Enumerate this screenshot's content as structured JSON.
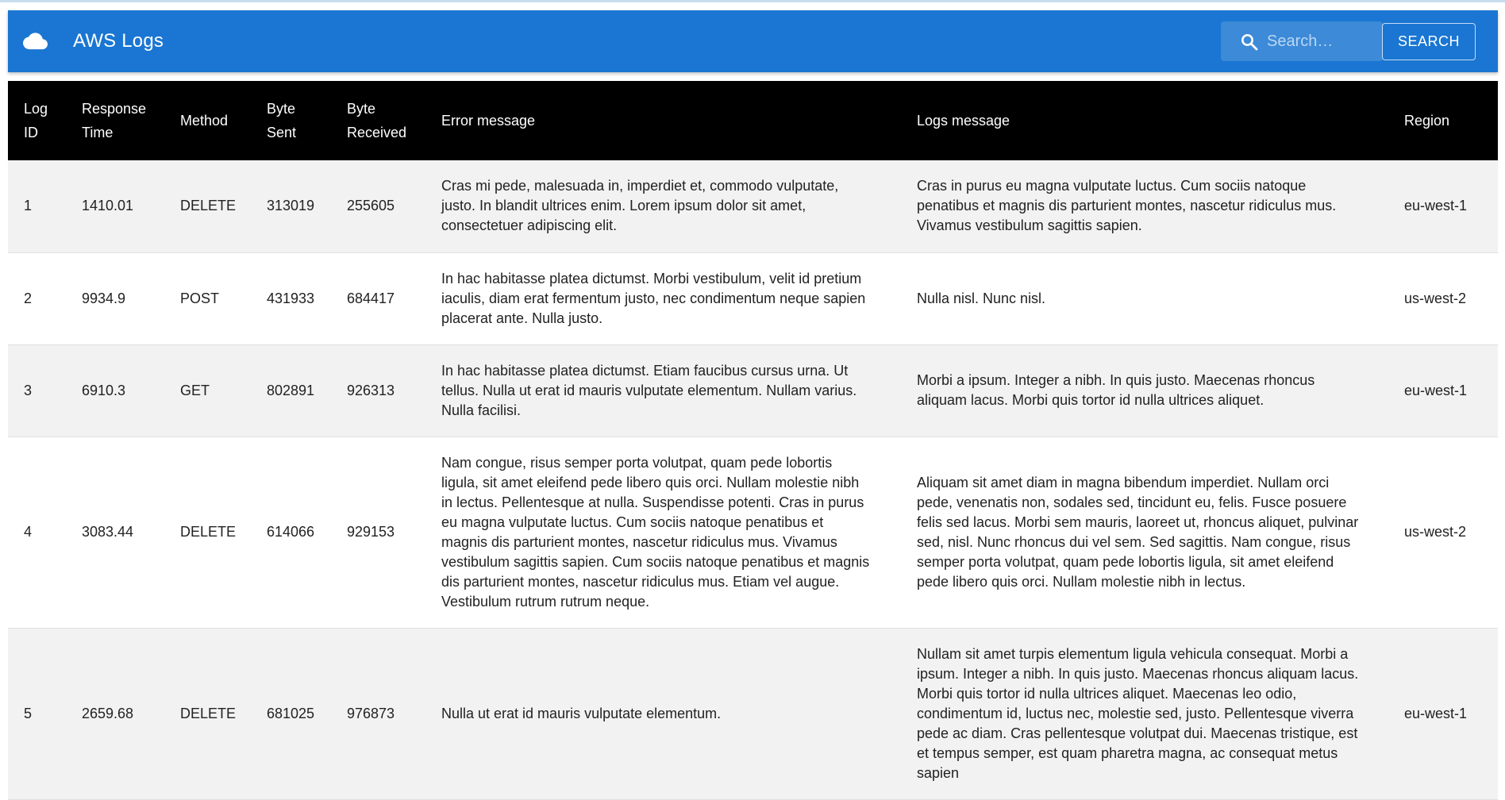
{
  "app": {
    "title": "AWS Logs",
    "icon": "cloud-icon"
  },
  "search": {
    "placeholder": "Search…",
    "value": "",
    "button_label": "SEARCH",
    "icon": "search-icon"
  },
  "colors": {
    "appbar": "#1a76d2",
    "header_row": "#000000",
    "row_odd": "#f2f2f2",
    "row_even": "#ffffff"
  },
  "table": {
    "columns": [
      "Log ID",
      "Response Time",
      "Method",
      "Byte Sent",
      "Byte Received",
      "Error message",
      "Logs message",
      "Region"
    ],
    "rows": [
      {
        "id": "1",
        "response_time": "1410.01",
        "method": "DELETE",
        "byte_sent": "313019",
        "byte_received": "255605",
        "error_message": "Cras mi pede, malesuada in, imperdiet et, commodo vulputate, justo. In blandit ultrices enim. Lorem ipsum dolor sit amet, consectetuer adipiscing elit.",
        "logs_message": "Cras in purus eu magna vulputate luctus. Cum sociis natoque penatibus et magnis dis parturient montes, nascetur ridiculus mus. Vivamus vestibulum sagittis sapien.",
        "region": "eu-west-1"
      },
      {
        "id": "2",
        "response_time": "9934.9",
        "method": "POST",
        "byte_sent": "431933",
        "byte_received": "684417",
        "error_message": "In hac habitasse platea dictumst. Morbi vestibulum, velit id pretium iaculis, diam erat fermentum justo, nec condimentum neque sapien placerat ante. Nulla justo.",
        "logs_message": "Nulla nisl. Nunc nisl.",
        "region": "us-west-2"
      },
      {
        "id": "3",
        "response_time": "6910.3",
        "method": "GET",
        "byte_sent": "802891",
        "byte_received": "926313",
        "error_message": "In hac habitasse platea dictumst. Etiam faucibus cursus urna. Ut tellus. Nulla ut erat id mauris vulputate elementum. Nullam varius. Nulla facilisi.",
        "logs_message": "Morbi a ipsum. Integer a nibh. In quis justo. Maecenas rhoncus aliquam lacus. Morbi quis tortor id nulla ultrices aliquet.",
        "region": "eu-west-1"
      },
      {
        "id": "4",
        "response_time": "3083.44",
        "method": "DELETE",
        "byte_sent": "614066",
        "byte_received": "929153",
        "error_message": "Nam congue, risus semper porta volutpat, quam pede lobortis ligula, sit amet eleifend pede libero quis orci. Nullam molestie nibh in lectus. Pellentesque at nulla. Suspendisse potenti. Cras in purus eu magna vulputate luctus. Cum sociis natoque penatibus et magnis dis parturient montes, nascetur ridiculus mus. Vivamus vestibulum sagittis sapien. Cum sociis natoque penatibus et magnis dis parturient montes, nascetur ridiculus mus. Etiam vel augue. Vestibulum rutrum rutrum neque.",
        "logs_message": "Aliquam sit amet diam in magna bibendum imperdiet. Nullam orci pede, venenatis non, sodales sed, tincidunt eu, felis. Fusce posuere felis sed lacus. Morbi sem mauris, laoreet ut, rhoncus aliquet, pulvinar sed, nisl. Nunc rhoncus dui vel sem. Sed sagittis. Nam congue, risus semper porta volutpat, quam pede lobortis ligula, sit amet eleifend pede libero quis orci. Nullam molestie nibh in lectus.",
        "region": "us-west-2"
      },
      {
        "id": "5",
        "response_time": "2659.68",
        "method": "DELETE",
        "byte_sent": "681025",
        "byte_received": "976873",
        "error_message": "Nulla ut erat id mauris vulputate elementum.",
        "logs_message": "Nullam sit amet turpis elementum ligula vehicula consequat. Morbi a ipsum. Integer a nibh. In quis justo. Maecenas rhoncus aliquam lacus. Morbi quis tortor id nulla ultrices aliquet. Maecenas leo odio, condimentum id, luctus nec, molestie sed, justo. Pellentesque viverra pede ac diam. Cras pellentesque volutpat dui. Maecenas tristique, est et tempus semper, est quam pharetra magna, ac consequat metus sapien",
        "region": "eu-west-1"
      }
    ]
  }
}
